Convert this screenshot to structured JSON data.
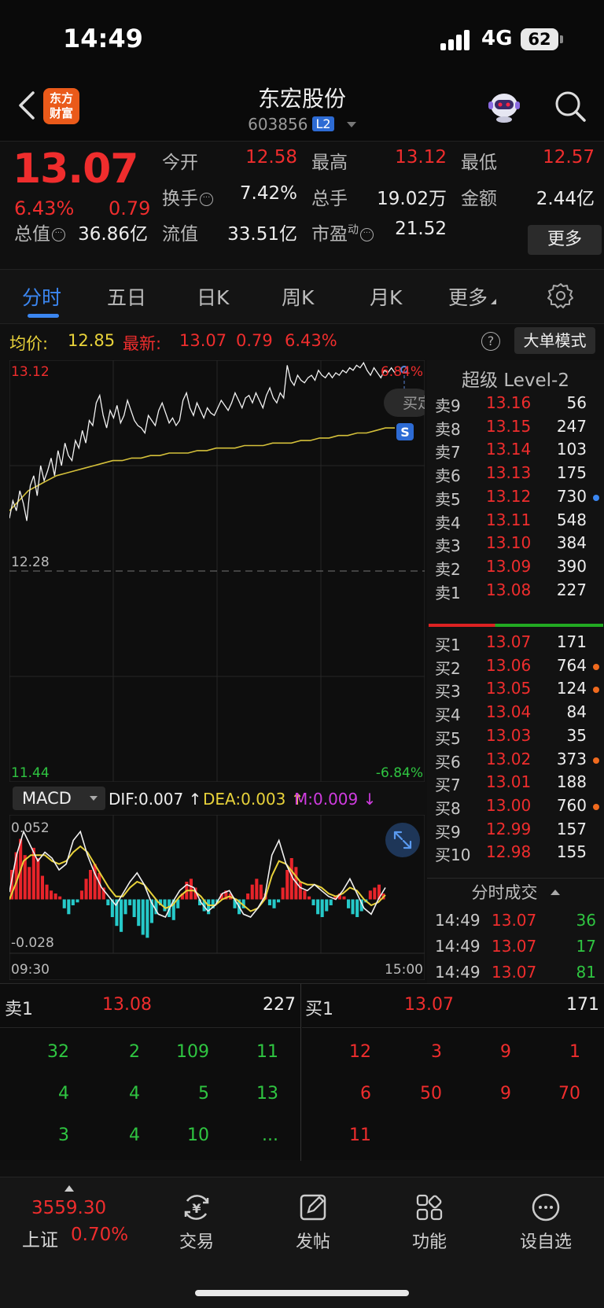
{
  "status": {
    "time": "14:49",
    "network": "4G",
    "battery": "62"
  },
  "header": {
    "logo_line1": "东方",
    "logo_line2": "财富",
    "title": "东宏股份",
    "code": "603856",
    "level_badge": "L2"
  },
  "quote": {
    "price": "13.07",
    "change_pct": "6.43%",
    "change": "0.79",
    "rows": [
      [
        {
          "label": "今开",
          "value": "12.58",
          "color": "red"
        },
        {
          "label": "最高",
          "value": "13.12",
          "color": "red"
        },
        {
          "label": "最低",
          "value": "12.57",
          "color": "red"
        }
      ],
      [
        {
          "label": "换手",
          "value": "7.42%",
          "color": "white"
        },
        {
          "label": "总手",
          "value": "19.02万",
          "color": "white"
        },
        {
          "label": "金额",
          "value": "2.44亿",
          "color": "white"
        }
      ],
      [
        {
          "label": "总值",
          "value": "36.86亿",
          "color": "white"
        },
        {
          "label": "流值",
          "value": "33.51亿",
          "color": "white"
        },
        {
          "label": "市盈",
          "sup": "动",
          "value": "21.52",
          "color": "white"
        }
      ]
    ],
    "more_label": "更多"
  },
  "tabs": [
    "分时",
    "五日",
    "日K",
    "周K",
    "月K",
    "更多"
  ],
  "avg_bar": {
    "avg_label": "均价:",
    "avg_value": "12.85",
    "latest_label": "最新:",
    "latest_value": "13.07",
    "latest_change": "0.79",
    "latest_pct": "6.43%",
    "help": "?",
    "big_order_label": "大单模式"
  },
  "chart": {
    "y_top": "13.12",
    "y_mid": "12.28",
    "y_bot": "11.44",
    "pct_top": "6.84%",
    "pct_bot": "-6.84%",
    "buy_tag": "买定",
    "sell_marker": "S",
    "price_line": [
      12.49,
      12.56,
      12.52,
      12.6,
      12.55,
      12.48,
      12.62,
      12.66,
      12.58,
      12.7,
      12.64,
      12.68,
      12.73,
      12.66,
      12.76,
      12.7,
      12.79,
      12.74,
      12.72,
      12.8,
      12.77,
      12.84,
      12.79,
      12.88,
      12.86,
      12.95,
      12.98,
      12.9,
      12.85,
      12.92,
      12.89,
      12.94,
      12.87,
      12.9,
      12.96,
      12.92,
      12.88,
      12.86,
      12.85,
      12.83,
      12.9,
      12.88,
      12.86,
      12.92,
      12.95,
      12.91,
      12.87,
      12.89,
      12.86,
      12.88,
      12.96,
      12.99,
      12.93,
      12.9,
      12.95,
      12.92,
      12.89,
      12.93,
      12.91,
      12.9,
      12.93,
      12.96,
      12.94,
      12.92,
      12.95,
      12.99,
      12.96,
      12.93,
      12.97,
      12.98,
      12.95,
      12.99,
      12.96,
      12.93,
      12.98,
      13.01,
      12.97,
      12.95,
      12.99,
      12.97,
      13.1,
      13.04,
      13.02,
      13.06,
      13.04,
      13.03,
      13.05,
      13.06,
      13.04,
      13.08,
      13.06,
      13.05,
      13.07,
      13.05,
      13.07,
      13.06,
      13.08,
      13.07,
      13.09,
      13.08,
      13.1,
      13.09,
      13.11,
      13.08,
      13.06,
      13.09,
      13.07,
      13.05,
      13.08,
      13.07,
      13.09,
      13.07
    ],
    "avg_line": [
      12.52,
      12.56,
      12.6,
      12.62,
      12.64,
      12.66,
      12.67,
      12.68,
      12.69,
      12.7,
      12.71,
      12.72,
      12.72,
      12.73,
      12.73,
      12.74,
      12.74,
      12.75,
      12.75,
      12.75,
      12.76,
      12.76,
      12.77,
      12.77,
      12.77,
      12.78,
      12.78,
      12.78,
      12.79,
      12.79,
      12.79,
      12.8,
      12.8,
      12.81,
      12.81,
      12.82,
      12.82,
      12.83,
      12.83,
      12.84,
      12.85,
      12.85
    ],
    "macd_label": "MACD",
    "dif_label": "DIF:0.007 ↑",
    "dea_label": "DEA:0.003 ↑",
    "m_label": "M:0.009 ↓",
    "macd_top": "0.052",
    "macd_bot": "-0.028",
    "time_start": "09:30",
    "time_end": "15:00",
    "macd_hist": [
      0.02,
      0.032,
      0.041,
      0.03,
      0.022,
      0.035,
      0.028,
      0.016,
      0.01,
      0.006,
      0.004,
      0.002,
      -0.006,
      -0.01,
      -0.004,
      -0.002,
      0.006,
      0.014,
      0.02,
      0.024,
      0.018,
      0.008,
      -0.004,
      -0.012,
      -0.018,
      -0.022,
      -0.01,
      -0.004,
      -0.012,
      -0.018,
      -0.024,
      -0.026,
      -0.016,
      -0.01,
      -0.004,
      -0.008,
      -0.012,
      -0.014,
      -0.006,
      0.004,
      0.012,
      0.014,
      0.008,
      -0.004,
      -0.008,
      -0.01,
      -0.006,
      -0.002,
      0.004,
      0.006,
      0.004,
      -0.006,
      -0.01,
      -0.006,
      0.004,
      0.01,
      0.014,
      0.01,
      0.004,
      -0.004,
      -0.006,
      -0.002,
      0.008,
      0.02,
      0.028,
      0.022,
      0.012,
      0.006,
      0.002,
      -0.004,
      -0.01,
      -0.012,
      -0.008,
      -0.004,
      0.002,
      0.004,
      0.002,
      -0.006,
      -0.01,
      -0.012,
      -0.008,
      -0.002,
      0.006,
      0.008,
      0.01,
      0.004
    ],
    "macd_dif": [
      0.005,
      0.03,
      0.046,
      0.036,
      0.026,
      0.032,
      0.028,
      0.02,
      0.024,
      0.04,
      0.046,
      0.03,
      0.018,
      0.008,
      0.002,
      -0.004,
      0.004,
      0.012,
      0.018,
      0.01,
      -0.002,
      -0.01,
      -0.012,
      -0.002,
      0.006,
      0.01,
      0.008,
      -0.002,
      -0.008,
      -0.004,
      0.004,
      0.006,
      -0.002,
      -0.01,
      -0.012,
      -0.006,
      0.002,
      0.03,
      0.04,
      0.024,
      0.014,
      0.008,
      0.006,
      0.01,
      0.006,
      0.002,
      0.0,
      0.006,
      0.014,
      0.004,
      -0.006,
      -0.01,
      0.0,
      0.008
    ],
    "macd_dea": [
      0.0,
      0.012,
      0.026,
      0.03,
      0.03,
      0.03,
      0.026,
      0.024,
      0.026,
      0.032,
      0.036,
      0.032,
      0.024,
      0.016,
      0.008,
      0.002,
      0.002,
      0.008,
      0.012,
      0.01,
      0.004,
      -0.002,
      -0.006,
      -0.004,
      0.002,
      0.006,
      0.006,
      0.002,
      -0.004,
      -0.004,
      0.0,
      0.002,
      0.0,
      -0.004,
      -0.008,
      -0.006,
      0.0,
      0.016,
      0.026,
      0.024,
      0.018,
      0.012,
      0.01,
      0.01,
      0.008,
      0.004,
      0.002,
      0.004,
      0.008,
      0.006,
      0.0,
      -0.004,
      -0.002,
      0.003
    ]
  },
  "book": {
    "title": "超级 Level-2",
    "asks": [
      {
        "label": "卖9",
        "price": "13.16",
        "vol": "56",
        "dot": ""
      },
      {
        "label": "卖8",
        "price": "13.15",
        "vol": "247",
        "dot": ""
      },
      {
        "label": "卖7",
        "price": "13.14",
        "vol": "103",
        "dot": ""
      },
      {
        "label": "卖6",
        "price": "13.13",
        "vol": "175",
        "dot": ""
      },
      {
        "label": "卖5",
        "price": "13.12",
        "vol": "730",
        "dot": "#3b86f0"
      },
      {
        "label": "卖4",
        "price": "13.11",
        "vol": "548",
        "dot": ""
      },
      {
        "label": "卖3",
        "price": "13.10",
        "vol": "384",
        "dot": ""
      },
      {
        "label": "卖2",
        "price": "13.09",
        "vol": "390",
        "dot": ""
      },
      {
        "label": "卖1",
        "price": "13.08",
        "vol": "227",
        "dot": ""
      }
    ],
    "bids": [
      {
        "label": "买1",
        "price": "13.07",
        "vol": "171",
        "dot": ""
      },
      {
        "label": "买2",
        "price": "13.06",
        "vol": "764",
        "dot": "#f06a1e"
      },
      {
        "label": "买3",
        "price": "13.05",
        "vol": "124",
        "dot": "#f06a1e"
      },
      {
        "label": "买4",
        "price": "13.04",
        "vol": "84",
        "dot": ""
      },
      {
        "label": "买5",
        "price": "13.03",
        "vol": "35",
        "dot": ""
      },
      {
        "label": "买6",
        "price": "13.02",
        "vol": "373",
        "dot": "#f06a1e"
      },
      {
        "label": "买7",
        "price": "13.01",
        "vol": "188",
        "dot": ""
      },
      {
        "label": "买8",
        "price": "13.00",
        "vol": "760",
        "dot": "#f06a1e"
      },
      {
        "label": "买9",
        "price": "12.99",
        "vol": "157",
        "dot": ""
      },
      {
        "label": "买10",
        "price": "12.98",
        "vol": "155",
        "dot": ""
      }
    ],
    "ticks_title": "分时成交",
    "ticks": [
      {
        "time": "14:49",
        "price": "13.07",
        "vol": "36",
        "color": "green"
      },
      {
        "time": "14:49",
        "price": "13.07",
        "vol": "17",
        "color": "green"
      },
      {
        "time": "14:49",
        "price": "13.07",
        "vol": "81",
        "color": "green"
      }
    ]
  },
  "level1": {
    "sell_label": "卖1",
    "sell_price": "13.08",
    "sell_vol": "227",
    "buy_label": "买1",
    "buy_price": "13.07",
    "buy_vol": "171",
    "sell_queue": [
      [
        "32",
        "2",
        "109",
        "11"
      ],
      [
        "4",
        "4",
        "5",
        "13"
      ],
      [
        "3",
        "4",
        "10",
        "..."
      ]
    ],
    "buy_queue": [
      [
        "12",
        "3",
        "9",
        "1"
      ],
      [
        "6",
        "50",
        "9",
        "70"
      ],
      [
        "11"
      ]
    ]
  },
  "tabbar": {
    "index_value": "3559.30",
    "index_name": "上证",
    "index_pct": "0.70%",
    "items": [
      {
        "label": "交易",
        "icon": "trade-icon"
      },
      {
        "label": "发帖",
        "icon": "post-icon"
      },
      {
        "label": "功能",
        "icon": "grid-icon"
      },
      {
        "label": "设自选",
        "icon": "more-circle-icon"
      }
    ]
  },
  "colors": {
    "up": "#ef2d2d",
    "down": "#2fc541",
    "accent": "#3b86f0",
    "avg": "#e8d23a"
  }
}
